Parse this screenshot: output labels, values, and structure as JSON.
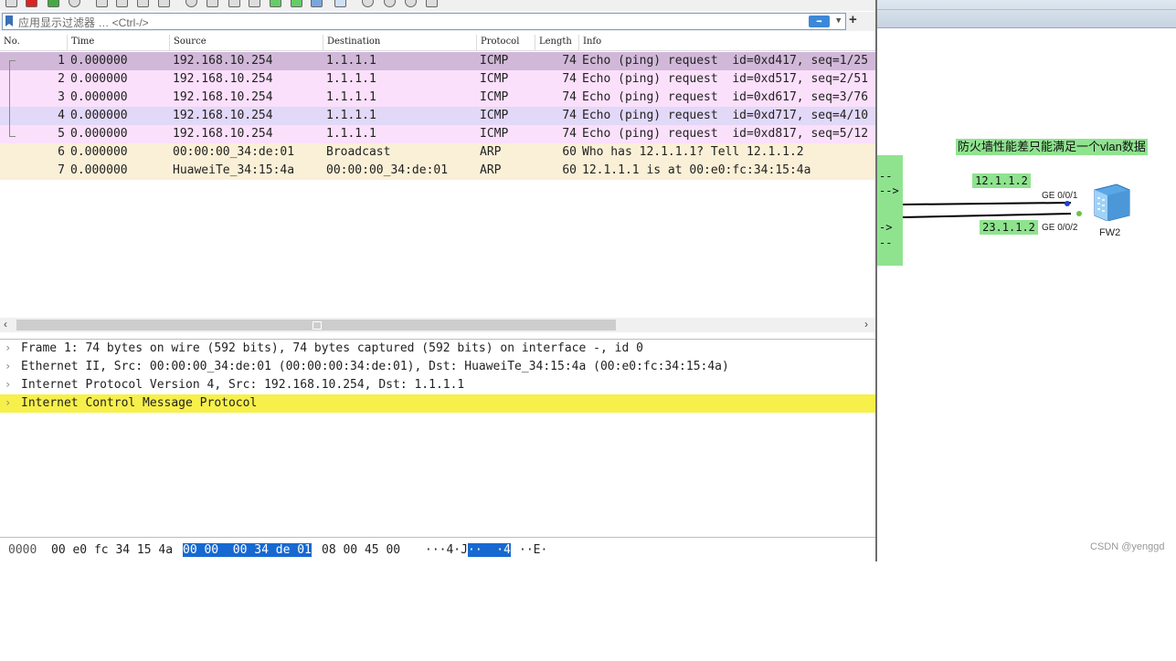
{
  "filter": {
    "placeholder": "应用显示过滤器 … <Ctrl-/>",
    "apply_icon": "right-arrow-icon",
    "add_icon": "+"
  },
  "packet_list": {
    "columns": [
      "No.",
      "Time",
      "Source",
      "Destination",
      "Protocol",
      "Length",
      "Info"
    ],
    "rows": [
      {
        "no": "1",
        "time": "0.000000",
        "source": "192.168.10.254",
        "destination": "1.1.1.1",
        "protocol": "ICMP",
        "length": "74",
        "info": "Echo (ping) request  id=0xd417, seq=1/25",
        "color": "#d1b8d9"
      },
      {
        "no": "2",
        "time": "0.000000",
        "source": "192.168.10.254",
        "destination": "1.1.1.1",
        "protocol": "ICMP",
        "length": "74",
        "info": "Echo (ping) request  id=0xd517, seq=2/51",
        "color": "#fbe0fb"
      },
      {
        "no": "3",
        "time": "0.000000",
        "source": "192.168.10.254",
        "destination": "1.1.1.1",
        "protocol": "ICMP",
        "length": "74",
        "info": "Echo (ping) request  id=0xd617, seq=3/76",
        "color": "#fbe0fb"
      },
      {
        "no": "4",
        "time": "0.000000",
        "source": "192.168.10.254",
        "destination": "1.1.1.1",
        "protocol": "ICMP",
        "length": "74",
        "info": "Echo (ping) request  id=0xd717, seq=4/10",
        "color": "#e2d8f8"
      },
      {
        "no": "5",
        "time": "0.000000",
        "source": "192.168.10.254",
        "destination": "1.1.1.1",
        "protocol": "ICMP",
        "length": "74",
        "info": "Echo (ping) request  id=0xd817, seq=5/12",
        "color": "#fbe0fb"
      },
      {
        "no": "6",
        "time": "0.000000",
        "source": "00:00:00_34:de:01",
        "destination": "Broadcast",
        "protocol": "ARP",
        "length": "60",
        "info": "Who has 12.1.1.1? Tell 12.1.1.2",
        "color": "#faf0d7"
      },
      {
        "no": "7",
        "time": "0.000000",
        "source": "HuaweiTe_34:15:4a",
        "destination": "00:00:00_34:de:01",
        "protocol": "ARP",
        "length": "60",
        "info": "12.1.1.1 is at 00:e0:fc:34:15:4a",
        "color": "#faf0d7"
      }
    ]
  },
  "details": [
    {
      "text": "Frame 1: 74 bytes on wire (592 bits), 74 bytes captured (592 bits) on interface -, id 0",
      "highlight": false
    },
    {
      "text": "Ethernet II, Src: 00:00:00_34:de:01 (00:00:00:34:de:01), Dst: HuaweiTe_34:15:4a (00:e0:fc:34:15:4a)",
      "highlight": false
    },
    {
      "text": "Internet Protocol Version 4, Src: 192.168.10.254, Dst: 1.1.1.1",
      "highlight": false
    },
    {
      "text": "Internet Control Message Protocol",
      "highlight": true
    }
  ],
  "bytes": {
    "offset": "0000",
    "hex_plain_1": "00 e0 fc 34 15 4a",
    "hex_highlight": "00 00  00 34 de 01",
    "hex_plain_2": "08 00 45 00",
    "ascii_plain_1": "···4·J",
    "ascii_highlight": "··  ·4",
    "ascii_plain_2": "··E·"
  },
  "topology": {
    "note": "防火墙性能差只能满足一个vlan数据",
    "ip_top": "12.1.1.2",
    "ip_bottom": "23.1.1.2",
    "port_top": "GE 0/0/1",
    "port_bottom": "GE 0/0/2",
    "device": "FW2",
    "left_box_lines": [
      "--",
      "-->",
      "->",
      "--"
    ]
  },
  "watermark": "CSDN @yenggd",
  "colors": {
    "detail_highlight": "#f7f04a",
    "byte_highlight": "#1769d1",
    "topology_label": "#8fe38f"
  }
}
